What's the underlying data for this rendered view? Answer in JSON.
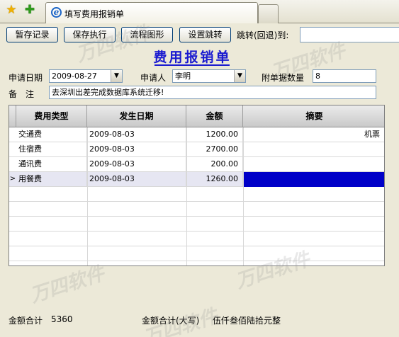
{
  "tab": {
    "title": "填写费用报销单"
  },
  "toolbar": {
    "draft_label": "暂存记录",
    "save_exec_label": "保存执行",
    "flowchart_label": "流程图形",
    "set_jump_label": "设置跳转",
    "jump_label": "跳转(回退)到:",
    "jump_value": ""
  },
  "form": {
    "title": "费用报销单",
    "apply_date_label": "申请日期",
    "apply_date_value": "2009-08-27",
    "applicant_label": "申请人",
    "applicant_value": "李明",
    "attach_count_label": "附单据数量",
    "attach_count_value": "8",
    "remark_label": "备　注",
    "remark_value": "去深圳出差完成数据库系统迁移!"
  },
  "grid": {
    "columns": [
      "费用类型",
      "发生日期",
      "金额",
      "摘要"
    ],
    "rows": [
      {
        "type": "交通费",
        "date": "2009-08-03",
        "amount": "1200.00",
        "memo": "机票"
      },
      {
        "type": "住宿费",
        "date": "2009-08-03",
        "amount": "2700.00",
        "memo": ""
      },
      {
        "type": "通讯费",
        "date": "2009-08-03",
        "amount": "200.00",
        "memo": ""
      },
      {
        "type": "用餐费",
        "date": "2009-08-03",
        "amount": "1260.00",
        "memo": ""
      }
    ],
    "current_row_marker": ">"
  },
  "footer": {
    "total_label": "金额合计",
    "total_value": "5360",
    "total_upper_label": "金额合计(大写)",
    "total_upper_value": "伍仟叁佰陆拾元整"
  },
  "icons": {
    "favorites": "star-icon",
    "add_favorite": "add-favorite-icon",
    "browser": "ie-icon",
    "dropdown": "chevron-down-icon"
  },
  "colors": {
    "title": "#1a1ad0",
    "selection": "#0000c8",
    "window_bg": "#ece9d8"
  }
}
